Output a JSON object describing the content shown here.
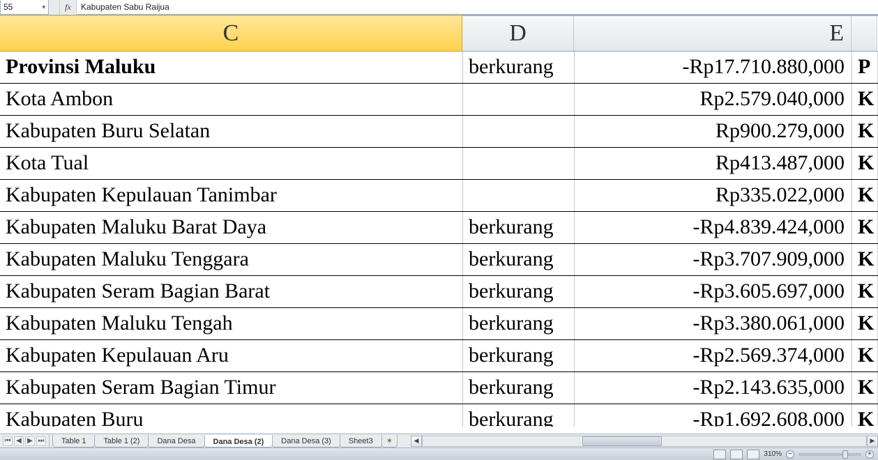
{
  "namebox": {
    "value": "55",
    "dropdown_glyph": "▾"
  },
  "formula": {
    "fx_label": "fx",
    "value": "Kabupaten Sabu Raijua"
  },
  "columns": {
    "C": "C",
    "D": "D",
    "E": "E",
    "F": ""
  },
  "rows": [
    {
      "c": "Provinsi Maluku",
      "d": "berkurang",
      "e": "-Rp17.710.880,000",
      "f": "P",
      "bold": true
    },
    {
      "c": "Kota Ambon",
      "d": "",
      "e": "Rp2.579.040,000",
      "f": "K"
    },
    {
      "c": "Kabupaten Buru Selatan",
      "d": "",
      "e": "Rp900.279,000",
      "f": "K"
    },
    {
      "c": "Kota Tual",
      "d": "",
      "e": "Rp413.487,000",
      "f": "K"
    },
    {
      "c": "Kabupaten Kepulauan Tanimbar",
      "d": "",
      "e": "Rp335.022,000",
      "f": "K"
    },
    {
      "c": "Kabupaten Maluku Barat Daya",
      "d": "berkurang",
      "e": "-Rp4.839.424,000",
      "f": "K"
    },
    {
      "c": "Kabupaten Maluku Tenggara",
      "d": "berkurang",
      "e": "-Rp3.707.909,000",
      "f": "K"
    },
    {
      "c": "Kabupaten Seram Bagian Barat",
      "d": "berkurang",
      "e": "-Rp3.605.697,000",
      "f": "K"
    },
    {
      "c": "Kabupaten Maluku Tengah",
      "d": "berkurang",
      "e": "-Rp3.380.061,000",
      "f": "K"
    },
    {
      "c": "Kabupaten Kepulauan Aru",
      "d": "berkurang",
      "e": "-Rp2.569.374,000",
      "f": "K"
    },
    {
      "c": "Kabupaten Seram Bagian Timur",
      "d": "berkurang",
      "e": "-Rp2.143.635,000",
      "f": "K"
    },
    {
      "c": "Kabupaten Buru",
      "d": "berkurang",
      "e": "-Rp1.692.608,000",
      "f": "K"
    }
  ],
  "tabs": {
    "nav": {
      "first": "⏮",
      "prev": "◀",
      "next": "▶",
      "last": "⏭"
    },
    "items": [
      {
        "label": "Table 1"
      },
      {
        "label": "Table 1 (2)"
      },
      {
        "label": "Dana Desa"
      },
      {
        "label": "Dana Desa (2)",
        "active": true
      },
      {
        "label": "Dana Desa (3)"
      },
      {
        "label": "Sheet3"
      }
    ],
    "new_glyph": "✶"
  },
  "hscroll": {
    "left": "◀",
    "right": "▶"
  },
  "status": {
    "zoom_label": "310%",
    "minus": "−",
    "plus": "+"
  }
}
